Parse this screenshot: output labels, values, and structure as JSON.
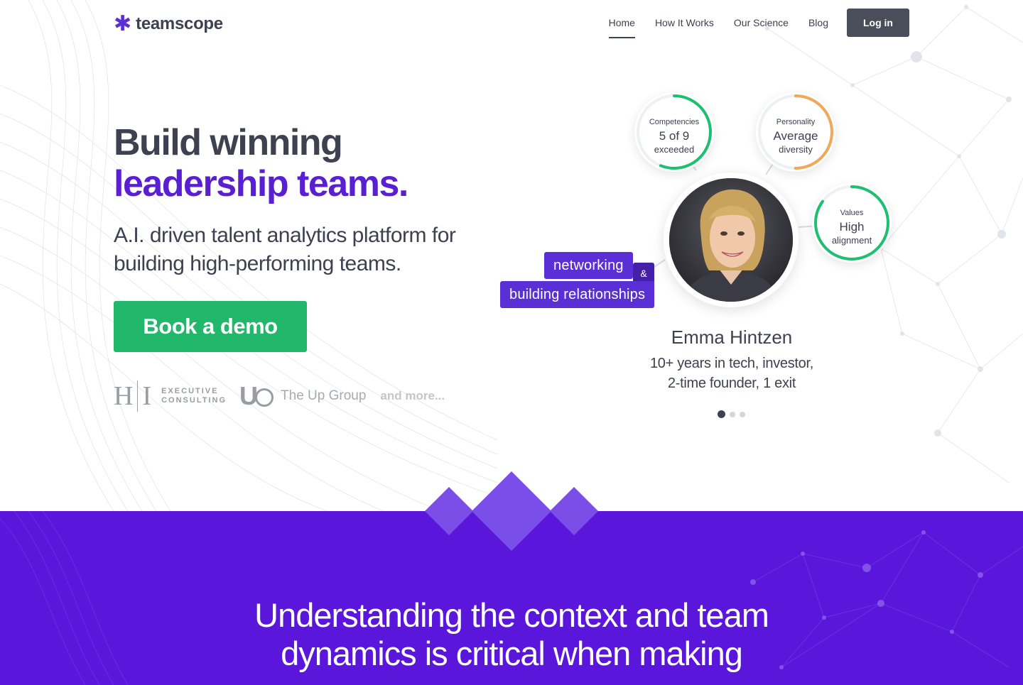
{
  "brand": {
    "name": "teamscope",
    "mark": "✱"
  },
  "nav": {
    "items": [
      {
        "label": "Home",
        "active": true
      },
      {
        "label": "How It Works",
        "active": false
      },
      {
        "label": "Our Science",
        "active": false
      },
      {
        "label": "Blog",
        "active": false
      }
    ],
    "login_label": "Log in"
  },
  "hero": {
    "title_line1": "Build winning",
    "title_line2": "leadership teams.",
    "subtitle": "A.I. driven talent analytics platform for building high-performing teams.",
    "cta_label": "Book a demo"
  },
  "clients": {
    "hi_letters_left": "H",
    "hi_letters_right": "I",
    "hi_line1": "EXECUTIVE",
    "hi_line2": "CONSULTING",
    "up_mark": "U",
    "up_name": "The Up Group",
    "more_label": "and more..."
  },
  "profile": {
    "bubbles": {
      "competencies": {
        "top": "Competencies",
        "mid": "5 of 9",
        "bottom": "exceeded",
        "progress": 0.56,
        "color": "#1fbf72"
      },
      "personality": {
        "top": "Personality",
        "mid": "Average",
        "bottom": "diversity",
        "progress": 0.5,
        "color": "#f0a85a"
      },
      "values": {
        "top": "Values",
        "mid": "High",
        "bottom": "alignment",
        "progress": 0.85,
        "color": "#1fbf72"
      }
    },
    "tags": {
      "tag1": "networking",
      "amp": "&",
      "tag2": "building relationships"
    },
    "name": "Emma Hintzen",
    "desc_line1": "10+ years in tech, investor,",
    "desc_line2": "2-time founder, 1 exit",
    "carousel": {
      "count": 3,
      "active_index": 0
    }
  },
  "statement": {
    "line1": "Understanding the context and team",
    "line2": "dynamics is critical when making"
  },
  "colors": {
    "accent": "#5b1fd3",
    "cta": "#21b86c",
    "section": "#5b16dc",
    "text": "#3d4150"
  }
}
